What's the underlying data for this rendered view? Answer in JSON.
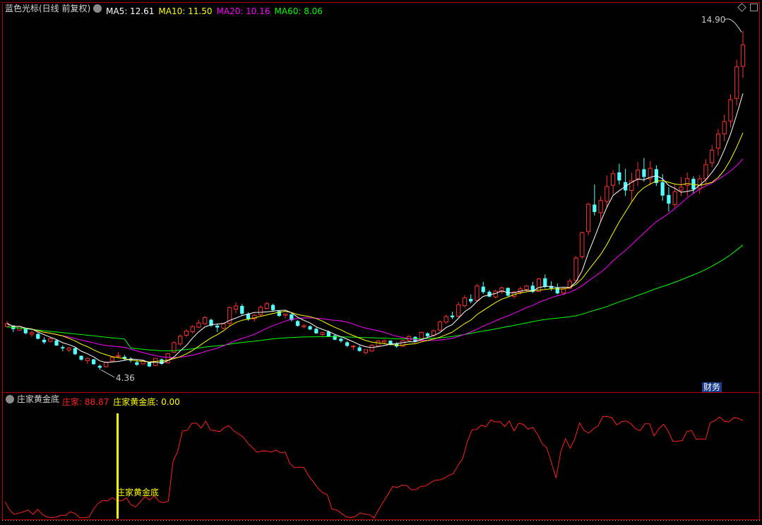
{
  "main_panel": {
    "title": "蓝色光标(日线 前复权)",
    "indicators": [
      {
        "label": "MA5: 12.61",
        "color": "#ffffff"
      },
      {
        "label": "MA10: 11.50",
        "color": "#ffff00"
      },
      {
        "label": "MA20: 10.16",
        "color": "#ff00ff"
      },
      {
        "label": "MA60: 8.06",
        "color": "#00ff00"
      }
    ],
    "high_label": "14.90",
    "low_label": "4.36",
    "finance_badge": "财务"
  },
  "sub_panel": {
    "title": "庄家黄金底",
    "indicators": [
      {
        "label": "庄家: 88.87",
        "color": "#ff2020"
      },
      {
        "label": "庄家黄金底: 0.00",
        "color": "#ffff00"
      }
    ],
    "signal_label": "庄家黄金底"
  },
  "colors": {
    "up": "#ff3030",
    "down": "#54ffff",
    "ma5": "#ffffff",
    "ma10": "#ffff00",
    "ma20": "#ff00ff",
    "ma60": "#00ff00",
    "zhuangjia": "#ff2020",
    "signal": "#ffff00",
    "frame": "#b40000"
  },
  "chart_data": [
    {
      "type": "candlestick",
      "title": "蓝色光标(日线 前复权)",
      "ylim": [
        4.0,
        15.2
      ],
      "candles": [
        [
          5.71,
          5.88,
          5.68,
          5.8
        ],
        [
          5.74,
          5.75,
          5.54,
          5.63
        ],
        [
          5.6,
          5.74,
          5.58,
          5.71
        ],
        [
          5.66,
          5.66,
          5.47,
          5.5
        ],
        [
          5.47,
          5.58,
          5.39,
          5.52
        ],
        [
          5.48,
          5.51,
          5.31,
          5.33
        ],
        [
          5.3,
          5.38,
          5.17,
          5.22
        ],
        [
          5.25,
          5.38,
          5.22,
          5.33
        ],
        [
          5.28,
          5.32,
          5.11,
          5.12
        ],
        [
          5.07,
          5.13,
          4.94,
          5.03
        ],
        [
          4.98,
          5.08,
          4.92,
          5.04
        ],
        [
          5.04,
          5.05,
          4.82,
          4.85
        ],
        [
          4.8,
          4.81,
          4.65,
          4.68
        ],
        [
          4.65,
          4.74,
          4.55,
          4.72
        ],
        [
          4.69,
          4.7,
          4.52,
          4.54
        ],
        [
          4.49,
          4.53,
          4.36,
          4.43
        ],
        [
          4.46,
          4.63,
          4.44,
          4.6
        ],
        [
          4.64,
          4.78,
          4.62,
          4.75
        ],
        [
          4.78,
          4.92,
          4.73,
          4.81
        ],
        [
          4.77,
          4.83,
          4.66,
          4.7
        ],
        [
          4.71,
          4.76,
          4.6,
          4.65
        ],
        [
          4.6,
          4.67,
          4.49,
          4.52
        ],
        [
          4.55,
          4.68,
          4.53,
          4.63
        ],
        [
          4.59,
          4.61,
          4.45,
          4.47
        ],
        [
          4.5,
          4.73,
          4.48,
          4.72
        ],
        [
          4.69,
          4.72,
          4.52,
          4.55
        ],
        [
          4.58,
          4.89,
          4.56,
          4.87
        ],
        [
          4.91,
          5.25,
          4.89,
          5.21
        ],
        [
          5.17,
          5.46,
          5.11,
          5.41
        ],
        [
          5.44,
          5.62,
          5.38,
          5.57
        ],
        [
          5.55,
          5.75,
          5.49,
          5.71
        ],
        [
          5.69,
          5.92,
          5.66,
          5.82
        ],
        [
          5.8,
          6.04,
          5.76,
          5.99
        ],
        [
          5.92,
          5.96,
          5.7,
          5.74
        ],
        [
          5.74,
          5.8,
          5.54,
          5.68
        ],
        [
          5.66,
          5.82,
          5.63,
          5.8
        ],
        [
          5.81,
          6.33,
          5.74,
          6.3
        ],
        [
          6.25,
          6.46,
          6.12,
          6.35
        ],
        [
          6.35,
          6.41,
          6.05,
          6.11
        ],
        [
          6.11,
          6.15,
          5.89,
          5.93
        ],
        [
          5.95,
          6.1,
          5.86,
          6.06
        ],
        [
          6.08,
          6.37,
          6.03,
          6.31
        ],
        [
          6.27,
          6.48,
          6.24,
          6.42
        ],
        [
          6.38,
          6.42,
          6.17,
          6.22
        ],
        [
          6.19,
          6.2,
          6.01,
          6.04
        ],
        [
          6.06,
          6.11,
          5.96,
          6.1
        ],
        [
          6.09,
          6.12,
          5.87,
          5.91
        ],
        [
          5.88,
          5.91,
          5.71,
          5.73
        ],
        [
          5.7,
          5.79,
          5.65,
          5.74
        ],
        [
          5.72,
          5.75,
          5.6,
          5.62
        ],
        [
          5.64,
          5.68,
          5.48,
          5.5
        ],
        [
          5.46,
          5.55,
          5.42,
          5.52
        ],
        [
          5.55,
          5.58,
          5.39,
          5.4
        ],
        [
          5.43,
          5.46,
          5.29,
          5.3
        ],
        [
          5.33,
          5.37,
          5.21,
          5.26
        ],
        [
          5.22,
          5.26,
          5.07,
          5.11
        ],
        [
          5.08,
          5.14,
          4.98,
          5.1
        ],
        [
          5.06,
          5.12,
          4.93,
          4.95
        ],
        [
          4.9,
          5.0,
          4.85,
          4.99
        ],
        [
          4.95,
          5.16,
          4.92,
          5.13
        ],
        [
          5.1,
          5.29,
          5.08,
          5.26
        ],
        [
          5.23,
          5.31,
          5.18,
          5.27
        ],
        [
          5.27,
          5.28,
          5.11,
          5.16
        ],
        [
          5.18,
          5.22,
          5.05,
          5.09
        ],
        [
          5.1,
          5.3,
          5.08,
          5.27
        ],
        [
          5.28,
          5.44,
          5.23,
          5.4
        ],
        [
          5.39,
          5.41,
          5.22,
          5.24
        ],
        [
          5.27,
          5.55,
          5.26,
          5.53
        ],
        [
          5.5,
          5.53,
          5.37,
          5.41
        ],
        [
          5.44,
          5.61,
          5.39,
          5.58
        ],
        [
          5.6,
          5.9,
          5.56,
          5.85
        ],
        [
          5.85,
          6.08,
          5.79,
          6.02
        ],
        [
          6.05,
          6.17,
          5.94,
          6.0
        ],
        [
          6.03,
          6.48,
          6.0,
          6.39
        ],
        [
          6.36,
          6.68,
          6.3,
          6.6
        ],
        [
          6.57,
          6.71,
          6.43,
          6.49
        ],
        [
          6.52,
          7.03,
          6.49,
          6.97
        ],
        [
          6.95,
          7.1,
          6.73,
          6.78
        ],
        [
          6.79,
          6.84,
          6.62,
          6.64
        ],
        [
          6.63,
          6.85,
          6.58,
          6.81
        ],
        [
          6.79,
          6.95,
          6.73,
          6.91
        ],
        [
          6.91,
          6.92,
          6.65,
          6.67
        ],
        [
          6.65,
          6.82,
          6.58,
          6.78
        ],
        [
          6.78,
          6.95,
          6.7,
          6.88
        ],
        [
          6.86,
          7.0,
          6.79,
          6.97
        ],
        [
          6.98,
          7.1,
          6.75,
          6.79
        ],
        [
          6.8,
          7.23,
          6.78,
          7.19
        ],
        [
          7.21,
          7.33,
          6.89,
          6.95
        ],
        [
          6.97,
          7.12,
          6.82,
          6.9
        ],
        [
          6.93,
          7.05,
          6.71,
          6.74
        ],
        [
          6.75,
          6.92,
          6.68,
          6.89
        ],
        [
          6.9,
          7.2,
          6.87,
          7.12
        ],
        [
          7.14,
          7.9,
          7.1,
          7.84
        ],
        [
          7.88,
          8.66,
          7.81,
          8.63
        ],
        [
          8.66,
          9.56,
          8.55,
          9.51
        ],
        [
          9.5,
          10.13,
          9.16,
          9.27
        ],
        [
          9.25,
          9.76,
          8.95,
          9.63
        ],
        [
          9.6,
          10.4,
          9.42,
          10.06
        ],
        [
          10.1,
          10.57,
          9.82,
          10.46
        ],
        [
          10.5,
          10.77,
          10.12,
          10.25
        ],
        [
          10.2,
          10.61,
          9.77,
          9.94
        ],
        [
          9.94,
          10.49,
          9.6,
          10.24
        ],
        [
          10.3,
          10.82,
          10.08,
          10.57
        ],
        [
          10.6,
          10.95,
          10.21,
          10.36
        ],
        [
          10.3,
          10.85,
          10.11,
          10.63
        ],
        [
          10.6,
          10.72,
          10.08,
          10.17
        ],
        [
          10.2,
          10.45,
          9.62,
          9.78
        ],
        [
          9.8,
          10.04,
          9.28,
          9.53
        ],
        [
          9.5,
          10.12,
          9.41,
          9.9
        ],
        [
          9.95,
          10.35,
          9.76,
          10.04
        ],
        [
          10.1,
          10.5,
          9.76,
          10.31
        ],
        [
          10.3,
          10.38,
          9.83,
          9.97
        ],
        [
          10.0,
          10.42,
          9.84,
          10.3
        ],
        [
          10.3,
          10.91,
          10.15,
          10.74
        ],
        [
          10.8,
          11.35,
          10.66,
          11.19
        ],
        [
          11.25,
          11.85,
          11.02,
          11.69
        ],
        [
          11.7,
          12.3,
          11.47,
          12.08
        ],
        [
          12.1,
          12.93,
          11.9,
          12.76
        ],
        [
          12.8,
          14.0,
          12.58,
          13.78
        ],
        [
          13.8,
          14.9,
          13.44,
          14.46
        ]
      ],
      "ma5_last": 12.61,
      "ma10_last": 11.5,
      "ma20_last": 10.16,
      "ma60_last": 8.06,
      "annotations": [
        {
          "label": "14.90",
          "value": 14.9
        },
        {
          "label": "4.36",
          "value": 4.36
        }
      ]
    },
    {
      "type": "line",
      "title": "庄家黄金底",
      "ylim": [
        0,
        100
      ],
      "series": [
        {
          "name": "庄家",
          "values": [
            14.8,
            7.3,
            3.3,
            4.3,
            5.7,
            7.2,
            3.2,
            7.9,
            3.2,
            0.9,
            0.2,
            0.8,
            2.5,
            2.3,
            5.6,
            4.1,
            0.1,
            0.1,
            0.8,
            8.3,
            13.5,
            16.0,
            15.6,
            18.6,
            15.8,
            15.7,
            18.3,
            12.0,
            10.1,
            14.8,
            19.4,
            16.3,
            20.4,
            14.9,
            13.9,
            15.6,
            52.0,
            61.1,
            79.5,
            79.8,
            86.3,
            86.5,
            82.1,
            88.3,
            80.1,
            79.7,
            78.8,
            82.6,
            84.1,
            79.4,
            76.8,
            73.8,
            68.3,
            64.2,
            59.8,
            61.2,
            61.1,
            60.0,
            62.0,
            59.4,
            60.1,
            49.7,
            45.8,
            46.4,
            46.1,
            38.5,
            33.1,
            27.3,
            23.1,
            21.2,
            8.2,
            7.3,
            4.3,
            1.1,
            0.3,
            1.3,
            4.7,
            3.4,
            3.1,
            0.0,
            7.4,
            14.5,
            21.4,
            28.7,
            27.7,
            30.0,
            29.6,
            25.8,
            25.8,
            28.8,
            29.1,
            31.8,
            34.4,
            34.7,
            36.0,
            38.8,
            40.5,
            48.1,
            54.3,
            69.8,
            80.4,
            80.9,
            84.7,
            83.3,
            89.4,
            87.6,
            88.0,
            83.4,
            88.6,
            79.3,
            86.4,
            85.5,
            81.0,
            82.7,
            76.5,
            68.0,
            64.0,
            50.7,
            36.5,
            60.5,
            72.3,
            63.7,
            72.2,
            86.7,
            80.0,
            77.5,
            81.3,
            84.2,
            92.6,
            92.7,
            91.2,
            84.8,
            87.8,
            88.5,
            86.0,
            81.4,
            79.7,
            86.0,
            86.0,
            74.9,
            81.5,
            85.5,
            79.2,
            70.0,
            70.2,
            70.6,
            78.8,
            79.8,
            71.9,
            72.2,
            71.8,
            86.9,
            88.8,
            92.2,
            88.3,
            87.6,
            91.5,
            91.0,
            88.9
          ]
        },
        {
          "name": "庄家黄金底",
          "values": [
            0.0
          ]
        }
      ]
    }
  ]
}
